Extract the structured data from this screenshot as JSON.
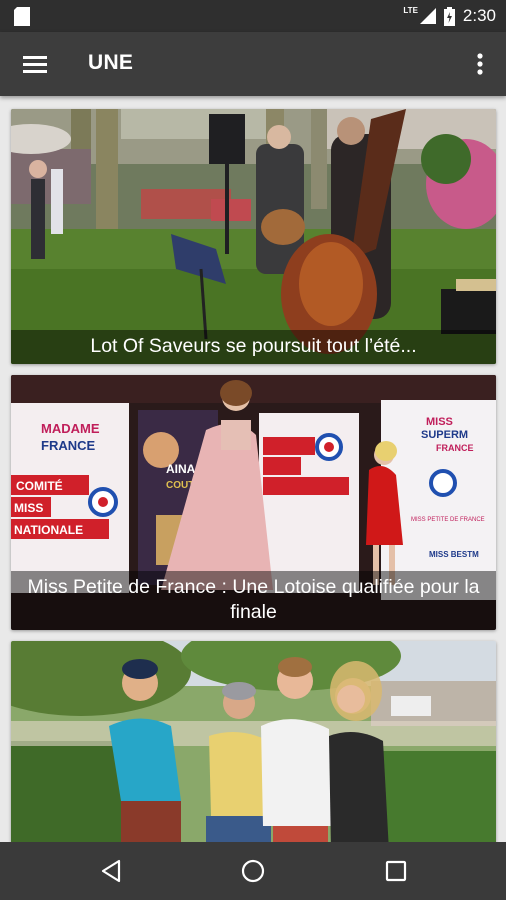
{
  "status_bar": {
    "network": "LTE",
    "time": "2:30",
    "icons": [
      "sim-card-icon",
      "signal-icon",
      "battery-icon"
    ]
  },
  "app_bar": {
    "title": "UNE",
    "icons": [
      "menu-icon",
      "more-vert-icon"
    ]
  },
  "articles": [
    {
      "title": "Lot Of Saveurs se poursuit tout l’été..."
    },
    {
      "title": "Miss Petite de France : Une Lotoise qualifiée pour la finale"
    },
    {
      "title": ""
    }
  ],
  "poster_text": {
    "madame": "MADAME",
    "france": "FRANCE",
    "comite": "COMITÉ",
    "miss": "MISS",
    "nationale": "NATIONALE",
    "aina": "AINA",
    "couture": "COUTURE",
    "miss_supermodel": "MISS",
    "supermodel": "SUPERM",
    "supermodel_france": "FRANCE",
    "petite": "MISS PETITE DE FRANCE",
    "bestm": "MISS BESTM"
  },
  "nav_bar": {
    "icons": [
      "back-icon",
      "home-icon",
      "recents-icon"
    ]
  },
  "colors": {
    "status_bar": "#2f2f2f",
    "app_bar": "#3d3d3d",
    "background": "#e9e9e9",
    "nav_bar": "#3a3a3a"
  }
}
